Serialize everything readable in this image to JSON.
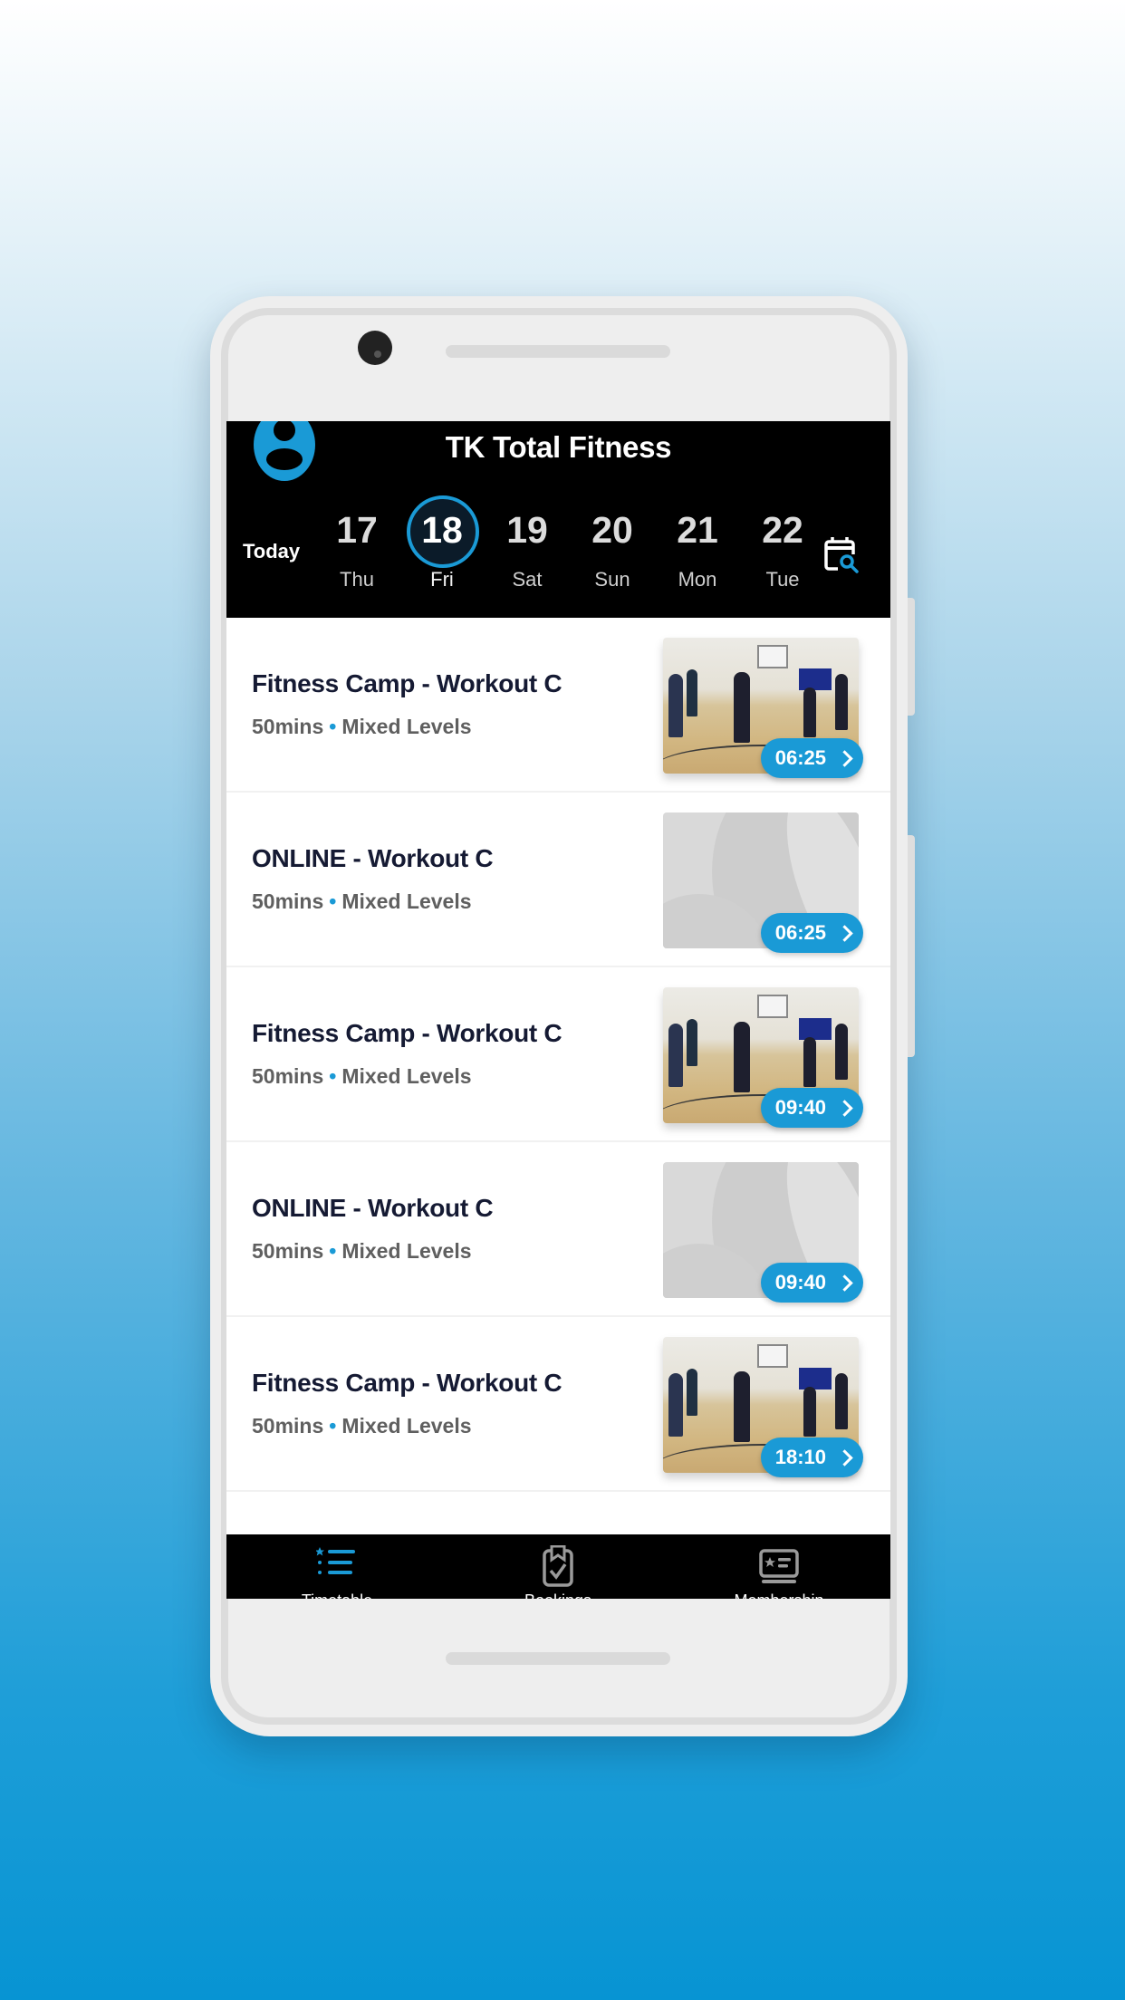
{
  "app": {
    "title": "TK Total Fitness"
  },
  "date_strip": {
    "today_label": "Today",
    "days": [
      {
        "num": "17",
        "dow": "Thu",
        "selected": false
      },
      {
        "num": "18",
        "dow": "Fri",
        "selected": true
      },
      {
        "num": "19",
        "dow": "Sat",
        "selected": false
      },
      {
        "num": "20",
        "dow": "Sun",
        "selected": false
      },
      {
        "num": "21",
        "dow": "Mon",
        "selected": false
      },
      {
        "num": "22",
        "dow": "Tue",
        "selected": false
      }
    ],
    "calendar_icon": "calendar-search-icon"
  },
  "classes": [
    {
      "name": "Fitness Camp - Workout C",
      "duration": "50mins",
      "level": "Mixed Levels",
      "time": "06:25",
      "thumbnail": "photo"
    },
    {
      "name": "ONLINE - Workout C",
      "duration": "50mins",
      "level": "Mixed Levels",
      "time": "06:25",
      "thumbnail": "placeholder"
    },
    {
      "name": "Fitness Camp - Workout C",
      "duration": "50mins",
      "level": "Mixed Levels",
      "time": "09:40",
      "thumbnail": "photo"
    },
    {
      "name": "ONLINE - Workout C",
      "duration": "50mins",
      "level": "Mixed Levels",
      "time": "09:40",
      "thumbnail": "placeholder"
    },
    {
      "name": "Fitness Camp - Workout C",
      "duration": "50mins",
      "level": "Mixed Levels",
      "time": "18:10",
      "thumbnail": "photo"
    }
  ],
  "meta_separator": "•",
  "bottom_nav": {
    "tabs": [
      {
        "label": "Timetable",
        "icon": "timetable-list-icon",
        "active": true
      },
      {
        "label": "Bookings",
        "icon": "bookings-clipboard-icon",
        "active": false
      },
      {
        "label": "Membership",
        "icon": "membership-card-icon",
        "active": false
      }
    ]
  },
  "colors": {
    "accent": "#1a9ad6",
    "header_bg": "#000000",
    "title_text": "#151a33",
    "meta_text": "#5f5f5f"
  }
}
